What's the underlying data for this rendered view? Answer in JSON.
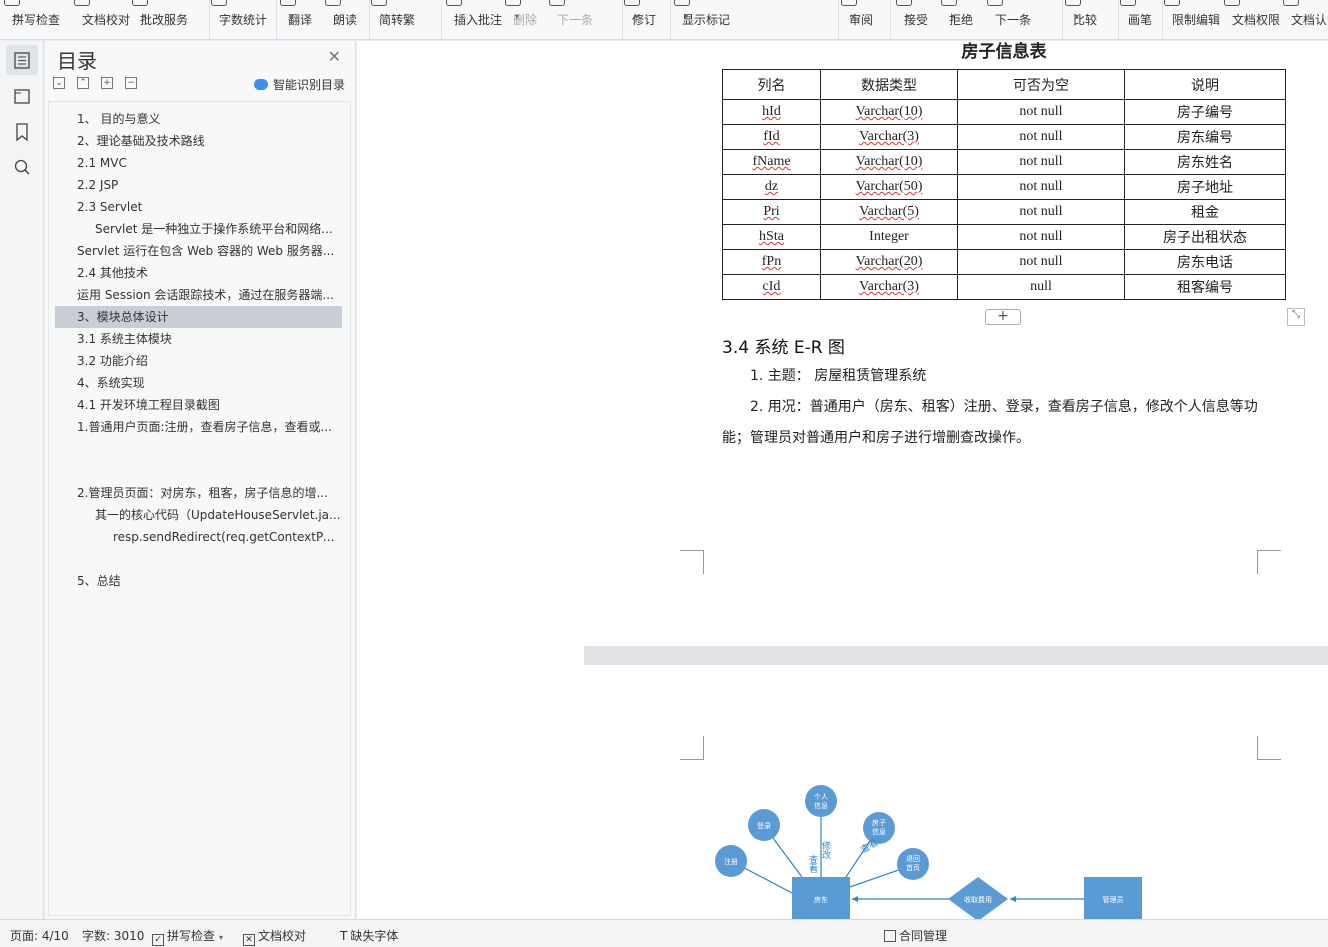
{
  "toolbar": {
    "items": [
      {
        "label": "拼写检查",
        "caret": true
      },
      {
        "label": "文档校对",
        "caret": false
      },
      {
        "label": "批改服务",
        "caret": true
      },
      {
        "label": "字数统计",
        "caret": false
      },
      {
        "label": "翻译",
        "caret": true
      },
      {
        "label": "朗读",
        "caret": false
      },
      {
        "label": "简转繁",
        "caret": false
      },
      {
        "label": "插入批注",
        "caret": false
      },
      {
        "label": "删除",
        "caret": true
      },
      {
        "label": "下一条",
        "caret": false
      },
      {
        "label": "修订",
        "caret": true
      },
      {
        "label": "显示标记",
        "caret": true
      },
      {
        "label": "审阅",
        "caret": true
      },
      {
        "label": "接受",
        "caret": true
      },
      {
        "label": "拒绝",
        "caret": true
      },
      {
        "label": "下一条",
        "caret": false
      },
      {
        "label": "比较",
        "caret": true
      },
      {
        "label": "画笔",
        "caret": false
      },
      {
        "label": "限制编辑",
        "caret": false
      },
      {
        "label": "文档权限",
        "caret": false
      },
      {
        "label": "文档认证",
        "caret": false
      }
    ]
  },
  "toc": {
    "title": "目录",
    "smart_label": "智能识别目录",
    "items": [
      {
        "text": "1、 目的与意义",
        "level": 1
      },
      {
        "text": "2、理论基础及技术路线",
        "level": 1
      },
      {
        "text": "2.1 MVC",
        "level": 1
      },
      {
        "text": "2.2 JSP",
        "level": 1
      },
      {
        "text": "2.3 Servlet",
        "level": 1
      },
      {
        "text": "Servlet 是一种独立于操作系统平台和网络...",
        "level": 2
      },
      {
        "text": "Servlet 运行在包含 Web 容器的 Web 服务器...",
        "level": 1
      },
      {
        "text": "2.4 其他技术",
        "level": 1
      },
      {
        "text": "运用 Session 会话跟踪技术，通过在服务器端...",
        "level": 1
      },
      {
        "text": "3、模块总体设计",
        "level": 1,
        "selected": true
      },
      {
        "text": "3.1 系统主体模块",
        "level": 1
      },
      {
        "text": "3.2 功能介绍",
        "level": 1
      },
      {
        "text": "4、系统实现",
        "level": 1
      },
      {
        "text": "4.1 开发环境工程目录截图",
        "level": 1
      },
      {
        "text": "1.普通用户页面:注册，查看房子信息，查看或...",
        "level": 1
      },
      {
        "text": "2.管理员页面：对房东，租客，房子信息的增...",
        "level": 1
      },
      {
        "text": "其一的核心代码（UpdateHouseServlet.ja...",
        "level": 2
      },
      {
        "text": "resp.sendRedirect(req.getContextPat...",
        "level": 3
      },
      {
        "text": "5、总结",
        "level": 1
      }
    ]
  },
  "document": {
    "table_title": "房子信息表",
    "headers": [
      "列名",
      "数据类型",
      "可否为空",
      "说明"
    ],
    "rows": [
      [
        "hId",
        "Varchar(10)",
        "not null",
        "房子编号"
      ],
      [
        "fId",
        "Varchar(3)",
        "not null",
        "房东编号"
      ],
      [
        "fName",
        "Varchar(10)",
        "not null",
        "房东姓名"
      ],
      [
        "dz",
        "Varchar(50)",
        "not null",
        "房子地址"
      ],
      [
        "Pri",
        "Varchar(5)",
        "not null",
        "租金"
      ],
      [
        "hSta",
        "Integer",
        "not null",
        "房子出租状态"
      ],
      [
        "fPn",
        "Varchar(20)",
        "not null",
        "房东电话"
      ],
      [
        "cId",
        "Varchar(3)",
        "null",
        "租客编号"
      ]
    ],
    "section_heading": "3.4 系统 E-R 图",
    "para1": "1.  主题：  房屋租赁管理系统",
    "para2_line1": "2.  用况：普通用户（房东、租客）注册、登录，查看房子信息，修改个人信息等功",
    "para2_line2": "能；管理员对普通用户和房子进行增删查改操作。"
  },
  "er": {
    "entity_landlord": "房东",
    "entity_admin": "管理员",
    "relation": "收取费用",
    "attr_register": "注册",
    "attr_login": "登录",
    "attr_personal_line1": "个人",
    "attr_personal_line2": "信息",
    "attr_house_line1": "房子",
    "attr_house_line2": "信息",
    "attr_return_line1": "退回",
    "attr_return_line2": "首页",
    "edge_view1": "查看",
    "edge_modify": "修改",
    "edge_view2": "查看"
  },
  "status": {
    "page": "页面: 4/10",
    "words": "字数: 3010",
    "spell": "拼写检查",
    "proof": "文档校对",
    "missing_font": "缺失字体",
    "contract": "合同管理"
  }
}
